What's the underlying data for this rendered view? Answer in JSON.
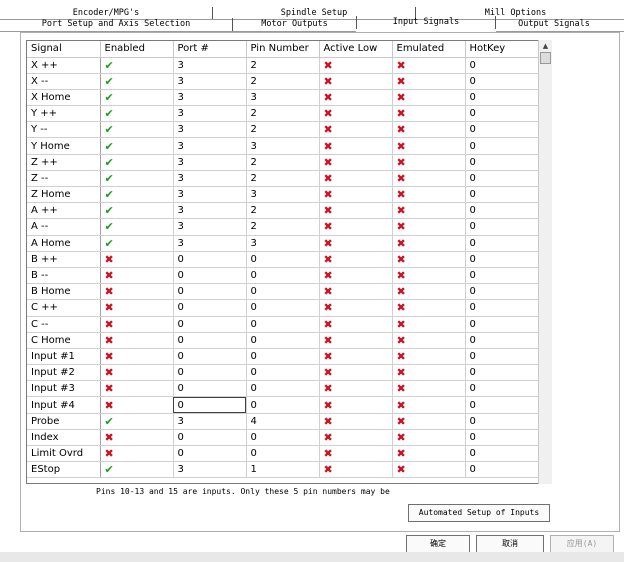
{
  "tabs": {
    "row1": [
      "Encoder/MPG's",
      "Spindle Setup",
      "Mill Options"
    ],
    "row2": [
      "Port Setup and Axis Selection",
      "Motor Outputs",
      "Input Signals",
      "Output Signals"
    ]
  },
  "table": {
    "columns": [
      "Signal",
      "Enabled",
      "Port #",
      "Pin Number",
      "Active Low",
      "Emulated",
      "HotKey"
    ],
    "rows": [
      {
        "signal": "X ++",
        "enabled": true,
        "port": "3",
        "pin": "2",
        "active_low": false,
        "emulated": false,
        "hotkey": "0"
      },
      {
        "signal": "X --",
        "enabled": true,
        "port": "3",
        "pin": "2",
        "active_low": false,
        "emulated": false,
        "hotkey": "0"
      },
      {
        "signal": "X Home",
        "enabled": true,
        "port": "3",
        "pin": "3",
        "active_low": false,
        "emulated": false,
        "hotkey": "0"
      },
      {
        "signal": "Y ++",
        "enabled": true,
        "port": "3",
        "pin": "2",
        "active_low": false,
        "emulated": false,
        "hotkey": "0"
      },
      {
        "signal": "Y --",
        "enabled": true,
        "port": "3",
        "pin": "2",
        "active_low": false,
        "emulated": false,
        "hotkey": "0"
      },
      {
        "signal": "Y Home",
        "enabled": true,
        "port": "3",
        "pin": "3",
        "active_low": false,
        "emulated": false,
        "hotkey": "0"
      },
      {
        "signal": "Z ++",
        "enabled": true,
        "port": "3",
        "pin": "2",
        "active_low": false,
        "emulated": false,
        "hotkey": "0"
      },
      {
        "signal": "Z --",
        "enabled": true,
        "port": "3",
        "pin": "2",
        "active_low": false,
        "emulated": false,
        "hotkey": "0"
      },
      {
        "signal": "Z Home",
        "enabled": true,
        "port": "3",
        "pin": "3",
        "active_low": false,
        "emulated": false,
        "hotkey": "0"
      },
      {
        "signal": "A ++",
        "enabled": true,
        "port": "3",
        "pin": "2",
        "active_low": false,
        "emulated": false,
        "hotkey": "0"
      },
      {
        "signal": "A --",
        "enabled": true,
        "port": "3",
        "pin": "2",
        "active_low": false,
        "emulated": false,
        "hotkey": "0"
      },
      {
        "signal": "A Home",
        "enabled": true,
        "port": "3",
        "pin": "3",
        "active_low": false,
        "emulated": false,
        "hotkey": "0"
      },
      {
        "signal": "B ++",
        "enabled": false,
        "port": "0",
        "pin": "0",
        "active_low": false,
        "emulated": false,
        "hotkey": "0"
      },
      {
        "signal": "B --",
        "enabled": false,
        "port": "0",
        "pin": "0",
        "active_low": false,
        "emulated": false,
        "hotkey": "0"
      },
      {
        "signal": "B Home",
        "enabled": false,
        "port": "0",
        "pin": "0",
        "active_low": false,
        "emulated": false,
        "hotkey": "0"
      },
      {
        "signal": "C ++",
        "enabled": false,
        "port": "0",
        "pin": "0",
        "active_low": false,
        "emulated": false,
        "hotkey": "0"
      },
      {
        "signal": "C --",
        "enabled": false,
        "port": "0",
        "pin": "0",
        "active_low": false,
        "emulated": false,
        "hotkey": "0"
      },
      {
        "signal": "C Home",
        "enabled": false,
        "port": "0",
        "pin": "0",
        "active_low": false,
        "emulated": false,
        "hotkey": "0"
      },
      {
        "signal": "Input #1",
        "enabled": false,
        "port": "0",
        "pin": "0",
        "active_low": false,
        "emulated": false,
        "hotkey": "0"
      },
      {
        "signal": "Input #2",
        "enabled": false,
        "port": "0",
        "pin": "0",
        "active_low": false,
        "emulated": false,
        "hotkey": "0"
      },
      {
        "signal": "Input #3",
        "enabled": false,
        "port": "0",
        "pin": "0",
        "active_low": false,
        "emulated": false,
        "hotkey": "0"
      },
      {
        "signal": "Input #4",
        "enabled": false,
        "port": "0",
        "pin": "0",
        "active_low": false,
        "emulated": false,
        "hotkey": "0"
      },
      {
        "signal": "Probe",
        "enabled": true,
        "port": "3",
        "pin": "4",
        "active_low": false,
        "emulated": false,
        "hotkey": "0"
      },
      {
        "signal": "Index",
        "enabled": false,
        "port": "0",
        "pin": "0",
        "active_low": false,
        "emulated": false,
        "hotkey": "0"
      },
      {
        "signal": "Limit Ovrd",
        "enabled": false,
        "port": "0",
        "pin": "0",
        "active_low": false,
        "emulated": false,
        "hotkey": "0"
      },
      {
        "signal": "EStop",
        "enabled": true,
        "port": "3",
        "pin": "1",
        "active_low": false,
        "emulated": false,
        "hotkey": "0"
      }
    ]
  },
  "note": "Pins 10-13 and 15 are inputs. Only these 5 pin numbers may be",
  "buttons": {
    "automated_setup": "Automated Setup of Inputs",
    "ok": "确定",
    "cancel": "取消",
    "apply": "应用(A)"
  },
  "icons": {
    "check": "green-check-icon",
    "cross": "red-x-icon"
  }
}
